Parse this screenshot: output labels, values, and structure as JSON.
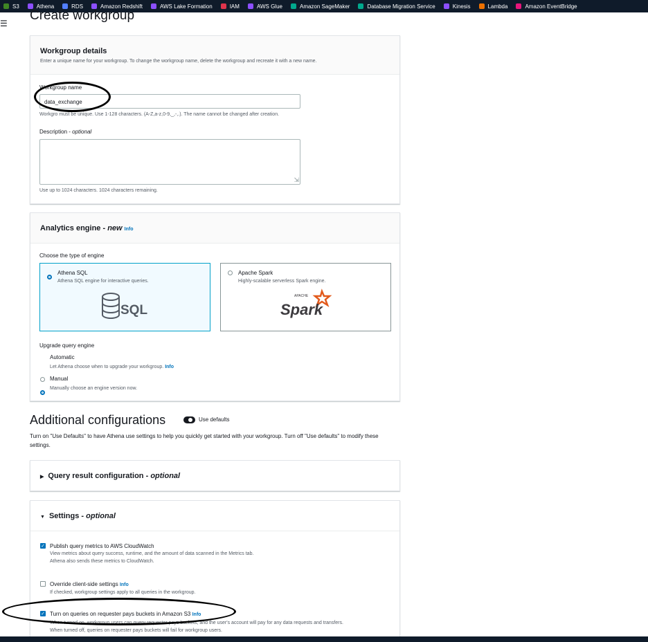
{
  "bookmarks": [
    {
      "label": "S3",
      "color": "#3f8624"
    },
    {
      "label": "Athena",
      "color": "#8c4fff"
    },
    {
      "label": "RDS",
      "color": "#527fff"
    },
    {
      "label": "Amazon Redshift",
      "color": "#8c4fff"
    },
    {
      "label": "AWS Lake Formation",
      "color": "#8c4fff"
    },
    {
      "label": "IAM",
      "color": "#dd344c"
    },
    {
      "label": "AWS Glue",
      "color": "#8c4fff"
    },
    {
      "label": "Amazon SageMaker",
      "color": "#01a88d"
    },
    {
      "label": "Database Migration Service",
      "color": "#01a88d"
    },
    {
      "label": "Kinesis",
      "color": "#8c4fff"
    },
    {
      "label": "Lambda",
      "color": "#ed7100"
    },
    {
      "label": "Amazon EventBridge",
      "color": "#e7157b"
    }
  ],
  "page_title": "Create workgroup",
  "workgroup_details": {
    "title": "Workgroup details",
    "description": "Enter a unique name for your workgroup. To change the workgroup name, delete the workgroup and recreate it with a new name.",
    "name_label": "Workgroup name",
    "name_value": "data_exchange",
    "name_hint_prefix": "Workgro",
    "name_hint": "must be unique. Use 1-128 characters. (A-Z,a-z,0-9,_,-,.). The name cannot be changed after creation.",
    "desc_label": "Description -",
    "desc_optional": "optional",
    "desc_hint": "Use up to 1024 characters. 1024 characters remaining."
  },
  "analytics_engine": {
    "title": "Analytics engine -",
    "title_new": "new",
    "info": "Info",
    "choose_label": "Choose the type of engine",
    "athena_title": "Athena SQL",
    "athena_desc": "Athena SQL engine for interactive queries.",
    "athena_logo": "SQL",
    "spark_title": "Apache Spark",
    "spark_desc": "Highly-scalable serverless Spark engine.",
    "spark_logo_small": "APACHE",
    "spark_logo": "Spark",
    "upgrade_label": "Upgrade query engine",
    "automatic_title": "Automatic",
    "automatic_desc": "Let Athena choose when to upgrade your workgroup.",
    "manual_title": "Manual",
    "manual_desc": "Manually choose an engine version now."
  },
  "additional": {
    "title": "Additional configurations",
    "use_defaults": "Use defaults",
    "description": "Turn on \"Use Defaults\" to have Athena use settings to help you quickly get started with your workgroup. Turn off \"Use defaults\" to modify these settings."
  },
  "query_result": {
    "title": "Query result configuration -",
    "optional": "optional"
  },
  "settings": {
    "title": "Settings -",
    "optional": "optional",
    "publish_title": "Publish query metrics to AWS CloudWatch",
    "publish_desc1": "View metrics about query success, runtime, and the amount of data scanned in the Metrics tab.",
    "publish_desc2": "Athena also sends these metrics to CloudWatch.",
    "override_title": "Override client-side settings",
    "override_desc": "If checked, workgroup settings apply to all queries in the workgroup.",
    "requester_title": "Turn on queries on requester pays buckets in Amazon S3",
    "requester_desc1": "When turned on, workgroup users can query requester pays buckets, and the user's account will pay for any data requests and transfers.",
    "requester_desc2": "When turned off, queries on requester pays buckets will fail for workgroup users.",
    "info": "Info"
  }
}
